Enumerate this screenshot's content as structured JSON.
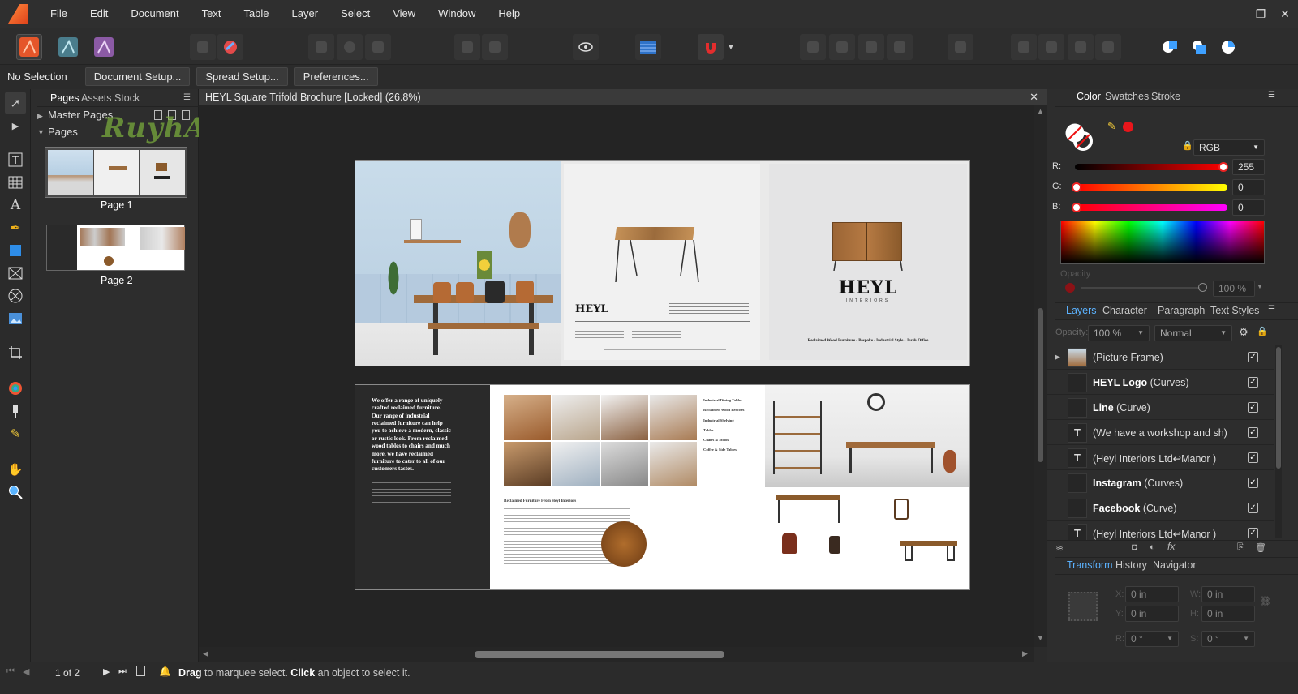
{
  "menu": [
    "File",
    "Edit",
    "Document",
    "Text",
    "Table",
    "Layer",
    "Select",
    "View",
    "Window",
    "Help"
  ],
  "window_controls": {
    "minimize": "–",
    "restore": "❐",
    "close": "✕"
  },
  "context": {
    "selection": "No Selection",
    "document_setup": "Document Setup...",
    "spread_setup": "Spread Setup...",
    "preferences": "Preferences..."
  },
  "pages_panel": {
    "tabs": [
      "Pages",
      "Assets",
      "Stock"
    ],
    "master_pages": "Master Pages",
    "pages": "Pages",
    "page1": "Page 1",
    "page2": "Page 2"
  },
  "watermark": "RuyhAaMe",
  "document": {
    "title": "HEYL Square Trifold Brochure [Locked] (26.8%)"
  },
  "brochure": {
    "logo": "HEYL",
    "logo_sub": "INTERIORS",
    "tagline": "Reclaimed Wood Furniture - Bespoke - Industrial Style - Jor & Office",
    "intro": "We offer a range of uniquely crafted reclaimed furniture. Our range of industrial reclaimed furniture can help you to achieve a modern, classic or rustic look. From reclaimed wood tables to chairs and much more, we have reclaimed furniture to cater to all of our customers tastes.",
    "categories": [
      "Industrial Dining Tables",
      "Reclaimed Wood Benches",
      "Industrial Shelving",
      "Tables",
      "Chairs & Stools",
      "Coffee & Side Tables"
    ],
    "section_heading": "Reclaimed Furniture From Heyl Interiors"
  },
  "color_panel": {
    "tabs": [
      "Color",
      "Swatches",
      "Stroke"
    ],
    "model": "RGB",
    "r_label": "R:",
    "r": "255",
    "g_label": "G:",
    "g": "0",
    "b_label": "B:",
    "b": "0",
    "opacity_label": "Opacity",
    "opacity": "100 %",
    "accent": "#e8161b"
  },
  "layers_panel": {
    "tabs": [
      "Layers",
      "Character",
      "Paragraph",
      "Text Styles"
    ],
    "opacity_label": "Opacity:",
    "opacity": "100 %",
    "blend": "Normal",
    "rows": [
      {
        "name": "",
        "type": "(Picture Frame)"
      },
      {
        "name": "HEYL Logo",
        "type": " (Curves)"
      },
      {
        "name": "Line",
        "type": " (Curve)"
      },
      {
        "name": "",
        "type": "(We have a workshop and sh)"
      },
      {
        "name": "",
        "type": "(Heyl Interiors Ltd↩Manor )"
      },
      {
        "name": "Instagram",
        "type": " (Curves)"
      },
      {
        "name": "Facebook",
        "type": " (Curve)"
      },
      {
        "name": "",
        "type": "(Heyl Interiors Ltd↩Manor )"
      }
    ]
  },
  "transform_panel": {
    "tabs": [
      "Transform",
      "History",
      "Navigator"
    ],
    "x_label": "X:",
    "x": "0 in",
    "y_label": "Y:",
    "y": "0 in",
    "w_label": "W:",
    "w": "0 in",
    "h_label": "H:",
    "h": "0 in",
    "r_label": "R:",
    "r": "0 °",
    "s_label": "S:",
    "s": "0 °"
  },
  "status": {
    "page_of": "1 of 2",
    "drag": "Drag",
    "drag_text": " to marquee select. ",
    "click": "Click",
    "click_text": " an object to select it."
  }
}
